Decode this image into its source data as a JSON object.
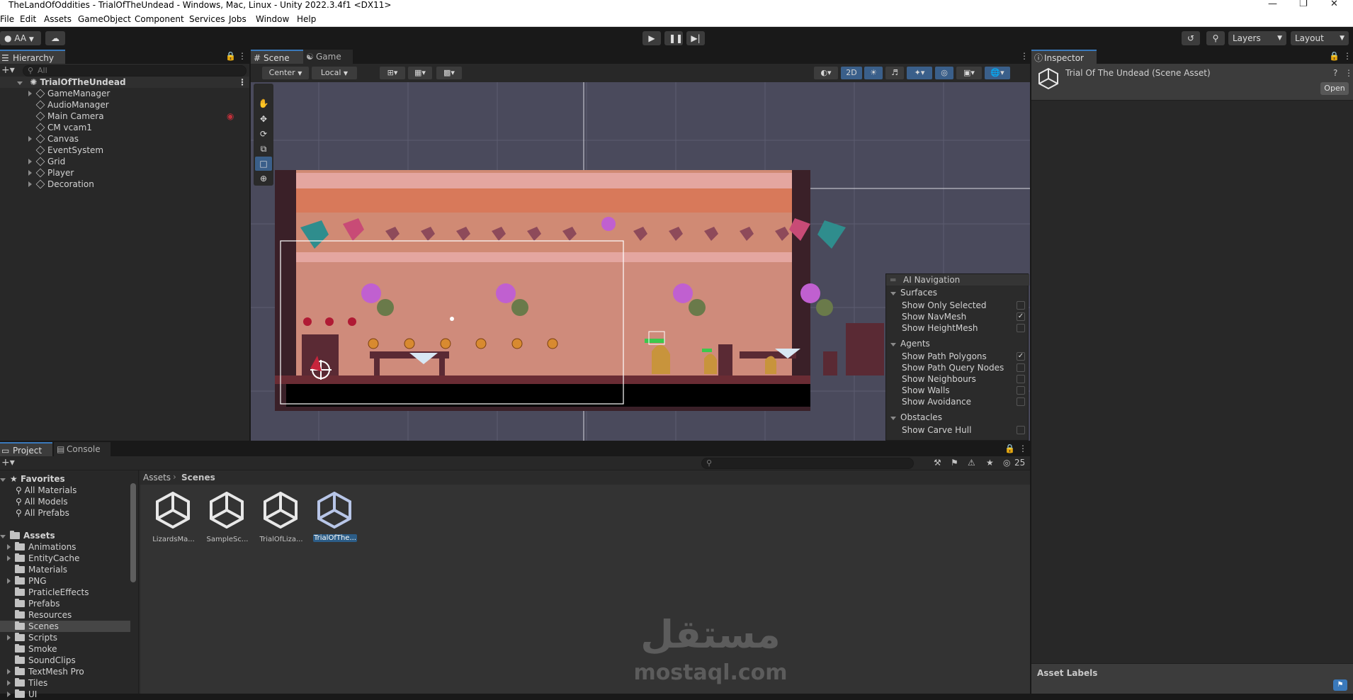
{
  "window": {
    "title": "TheLandOfOddities - TrialOfTheUndead - Windows, Mac, Linux - Unity 2022.3.4f1 <DX11>"
  },
  "menu": [
    "File",
    "Edit",
    "Assets",
    "GameObject",
    "Component",
    "Services",
    "Jobs",
    "Window",
    "Help"
  ],
  "toolbar": {
    "account": "AA",
    "layers": "Layers",
    "layout": "Layout"
  },
  "hierarchy": {
    "tab": "Hierarchy",
    "search_placeholder": "All",
    "scene": "TrialOfTheUndead",
    "items": [
      "GameManager",
      "AudioManager",
      "Main Camera",
      "CM vcam1",
      "Canvas",
      "EventSystem",
      "Grid",
      "Player",
      "Decoration"
    ]
  },
  "scene_view": {
    "tabs": [
      "Scene",
      "Game"
    ],
    "pivot": "Center",
    "space": "Local",
    "mode_2d": "2D"
  },
  "ai_navigation": {
    "title": "AI Navigation",
    "surfaces_header": "Surfaces",
    "surfaces": [
      {
        "label": "Show Only Selected",
        "checked": false
      },
      {
        "label": "Show NavMesh",
        "checked": true
      },
      {
        "label": "Show HeightMesh",
        "checked": false
      }
    ],
    "agents_header": "Agents",
    "agents": [
      {
        "label": "Show Path Polygons",
        "checked": true
      },
      {
        "label": "Show Path Query Nodes",
        "checked": false
      },
      {
        "label": "Show Neighbours",
        "checked": false
      },
      {
        "label": "Show Walls",
        "checked": false
      },
      {
        "label": "Show Avoidance",
        "checked": false
      }
    ],
    "obstacles_header": "Obstacles",
    "obstacles": [
      {
        "label": "Show Carve Hull",
        "checked": false
      }
    ]
  },
  "inspector": {
    "tab": "Inspector",
    "asset_title": "Trial Of The Undead (Scene Asset)",
    "open_button": "Open",
    "asset_labels": "Asset Labels"
  },
  "project": {
    "tabs": [
      "Project",
      "Console"
    ],
    "favorites_header": "Favorites",
    "favorites": [
      "All Materials",
      "All Models",
      "All Prefabs"
    ],
    "assets_header": "Assets",
    "folders": [
      "Animations",
      "EntityCache",
      "Materials",
      "PNG",
      "PraticleEffects",
      "Prefabs",
      "Resources",
      "Scenes",
      "Scripts",
      "Smoke",
      "SoundClips",
      "TextMesh Pro",
      "Tiles",
      "UI"
    ],
    "breadcrumb": [
      "Assets",
      "Scenes"
    ],
    "files": [
      "LizardsMa...",
      "SampleSc...",
      "TrialOfLiza...",
      "TrialOfThe..."
    ],
    "hidden_count": "25"
  },
  "watermark": {
    "arabic": "مستقل",
    "latin": "mostaql.com"
  },
  "colors": {
    "selection": "#2c5d87",
    "accent": "#3a79bb",
    "panel": "#282828",
    "scene_bg": "#4a4a5c"
  }
}
